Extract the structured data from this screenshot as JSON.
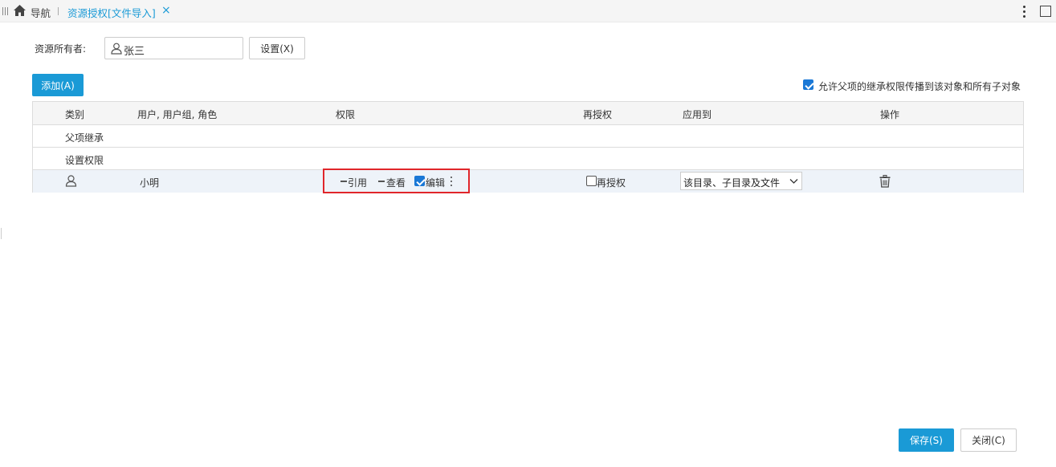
{
  "tabbar": {
    "nav_label": "导航",
    "active_tab": "资源授权[文件导入]",
    "close_glyph": "×"
  },
  "owner": {
    "label": "资源所有者:",
    "value": "张三",
    "set_button": "设置(X)"
  },
  "toolbar": {
    "add_button": "添加(A)",
    "inherit_checked": true,
    "inherit_label": "允许父项的继承权限传播到该对象和所有子对象"
  },
  "table": {
    "headers": {
      "type": "类别",
      "user": "用户, 用户组, 角色",
      "perm": "权限",
      "regrant": "再授权",
      "apply": "应用到",
      "action": "操作"
    },
    "groups": [
      "父项继承",
      "设置权限"
    ],
    "rows": [
      {
        "type_icon": "user-icon",
        "user": "小明",
        "perms": {
          "ref": {
            "label": "引用",
            "state": "indeterminate"
          },
          "view": {
            "label": "查看",
            "state": "indeterminate"
          },
          "edit": {
            "label": "编辑",
            "state": "checked"
          }
        },
        "regrant": {
          "label": "再授权",
          "checked": false
        },
        "apply_to": "该目录、子目录及文件",
        "action_icon": "trash-icon"
      }
    ]
  },
  "footer": {
    "save_button": "保存(S)",
    "close_button": "关闭(C)"
  },
  "colors": {
    "accent": "#1a9ad6",
    "highlight_border": "#e0262b",
    "selected_row": "#eef3f9"
  }
}
